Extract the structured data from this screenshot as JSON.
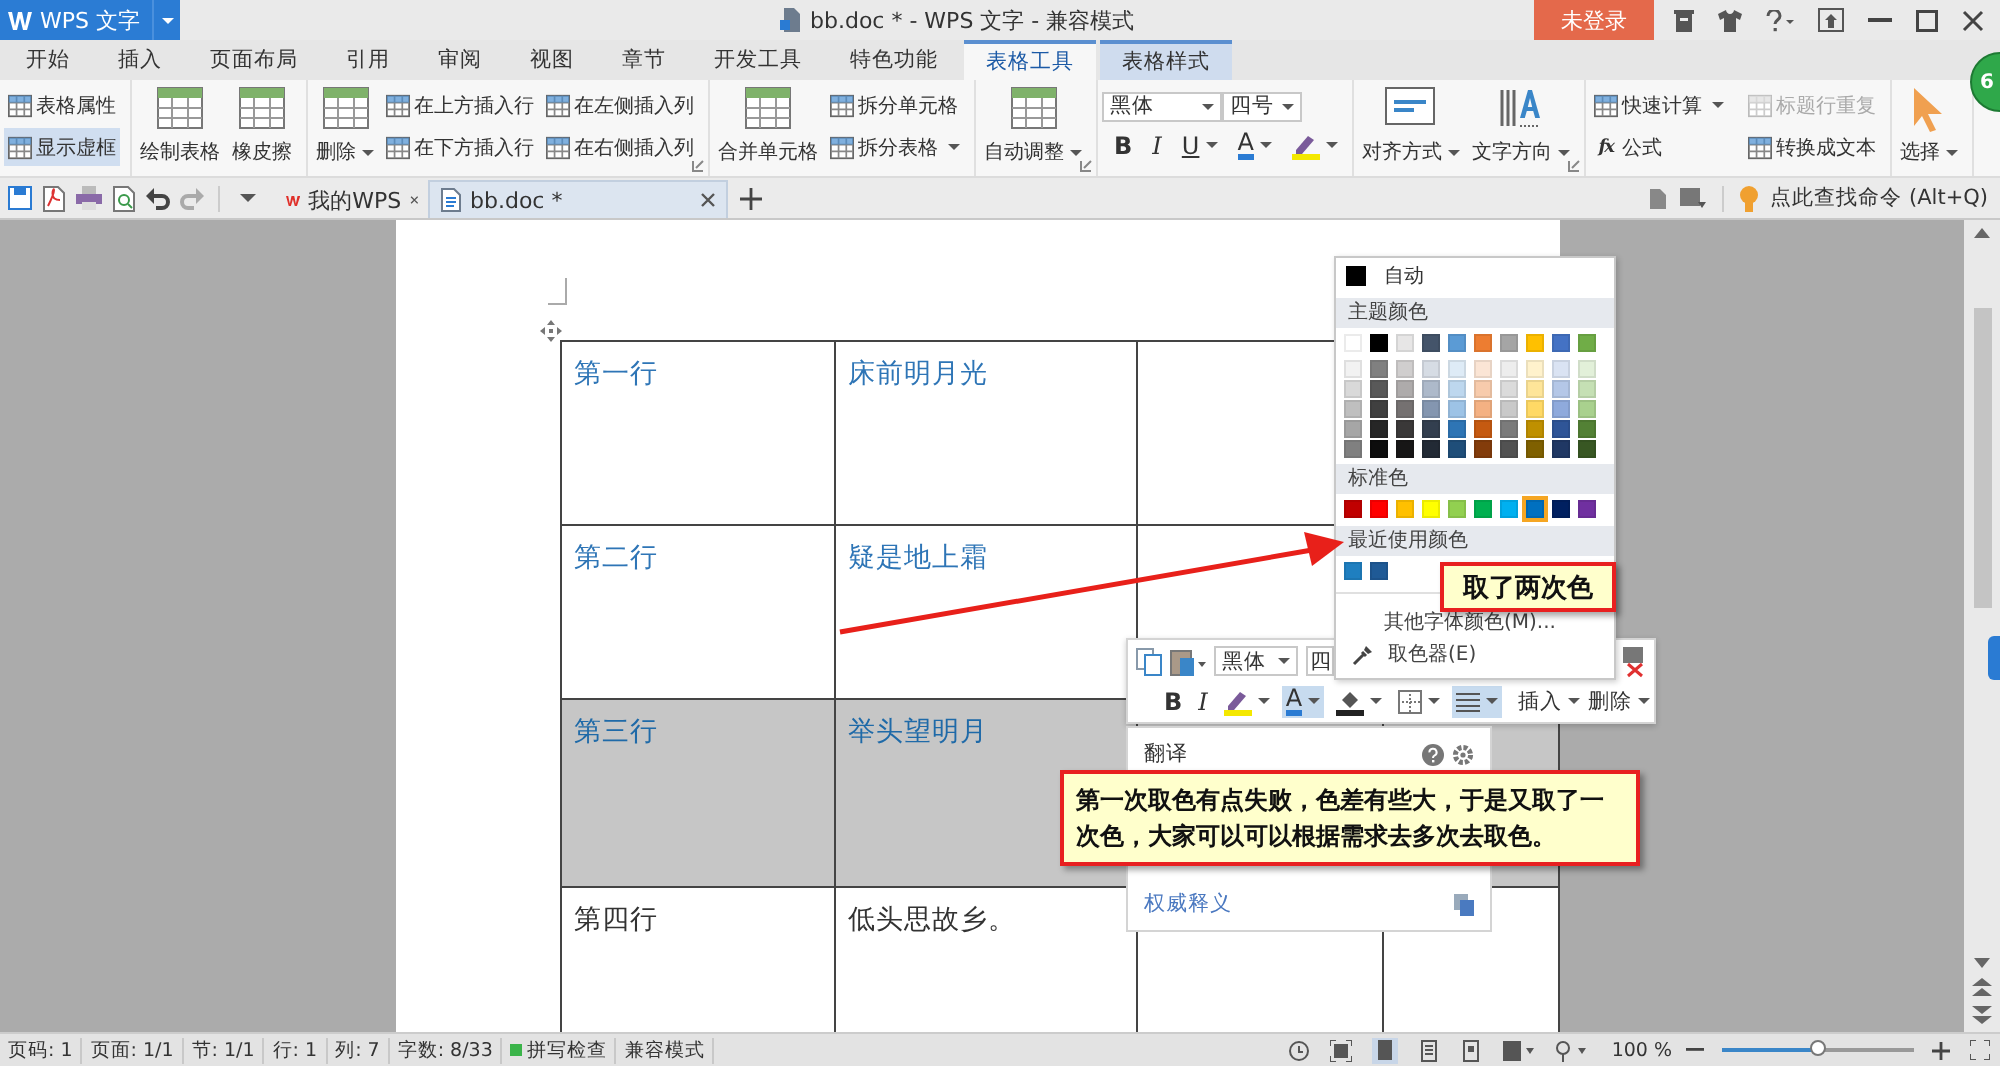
{
  "window": {
    "app_button": "WPS 文字",
    "title": "bb.doc * - WPS 文字 - 兼容模式",
    "login_button": "未登录",
    "badge": "6"
  },
  "menu_tabs": [
    {
      "label": "开始",
      "selected": false,
      "contextual": false
    },
    {
      "label": "插入",
      "selected": false,
      "contextual": false
    },
    {
      "label": "页面布局",
      "selected": false,
      "contextual": false
    },
    {
      "label": "引用",
      "selected": false,
      "contextual": false
    },
    {
      "label": "审阅",
      "selected": false,
      "contextual": false
    },
    {
      "label": "视图",
      "selected": false,
      "contextual": false
    },
    {
      "label": "章节",
      "selected": false,
      "contextual": false
    },
    {
      "label": "开发工具",
      "selected": false,
      "contextual": false
    },
    {
      "label": "特色功能",
      "selected": false,
      "contextual": false
    },
    {
      "label": "表格工具",
      "selected": true,
      "contextual": true
    },
    {
      "label": "表格样式",
      "selected": false,
      "contextual": true
    }
  ],
  "ribbon": {
    "groups": [
      {
        "launcher": false,
        "items": [
          {
            "kind": "small",
            "label": "表格属性",
            "dropdown": false,
            "on": false
          },
          {
            "kind": "small",
            "label": "显示虚框",
            "dropdown": false,
            "on": true
          }
        ]
      },
      {
        "launcher": false,
        "items": [
          {
            "kind": "large",
            "label": "绘制表格",
            "dropdown": false
          },
          {
            "kind": "large",
            "label": "橡皮擦",
            "dropdown": false
          }
        ]
      },
      {
        "launcher": true,
        "items": [
          {
            "kind": "large",
            "label": "删除",
            "dropdown": true
          },
          {
            "kind": "small",
            "label": "在上方插入行",
            "dropdown": false
          },
          {
            "kind": "small",
            "label": "在下方插入行",
            "dropdown": false
          },
          {
            "kind": "small",
            "label": "在左侧插入列",
            "dropdown": false
          },
          {
            "kind": "small",
            "label": "在右侧插入列",
            "dropdown": false
          }
        ]
      },
      {
        "launcher": false,
        "items": [
          {
            "kind": "large",
            "label": "合并单元格",
            "dropdown": false
          },
          {
            "kind": "small",
            "label": "拆分单元格",
            "dropdown": false
          },
          {
            "kind": "small",
            "label": "拆分表格",
            "dropdown": true
          }
        ]
      },
      {
        "launcher": true,
        "items": [
          {
            "kind": "large",
            "label": "自动调整",
            "dropdown": true
          }
        ]
      },
      {
        "launcher": false,
        "items": [
          {
            "kind": "font",
            "font": "黑体",
            "size": "四号",
            "buttons": [
              {
                "kind": "bold",
                "label": "B",
                "dropdown": false
              },
              {
                "kind": "italic",
                "label": "I",
                "dropdown": false
              },
              {
                "kind": "underline",
                "label": "U",
                "dropdown": true
              },
              {
                "kind": "font_color",
                "label": "A",
                "dropdown": true
              },
              {
                "kind": "highlight",
                "dropdown": true
              }
            ]
          }
        ]
      },
      {
        "launcher": true,
        "items": [
          {
            "kind": "large",
            "label": "对齐方式",
            "dropdown": true
          },
          {
            "kind": "large",
            "label": "文字方向",
            "dropdown": true
          }
        ]
      },
      {
        "launcher": false,
        "items": [
          {
            "kind": "small",
            "label": "快速计算",
            "dropdown": true,
            "disabled": false
          },
          {
            "kind": "small",
            "label": "标题行重复",
            "dropdown": false,
            "disabled": true
          },
          {
            "kind": "small",
            "label": "公式",
            "symbol": "fx",
            "dropdown": false,
            "disabled": false
          },
          {
            "kind": "small",
            "label": "转换成文本",
            "dropdown": false,
            "disabled": false
          }
        ]
      },
      {
        "launcher": false,
        "items": [
          {
            "kind": "large",
            "label": "选择",
            "dropdown": true
          }
        ]
      }
    ]
  },
  "doc_tabs": [
    {
      "kind": "home",
      "label": "我的WPS",
      "selected": false
    },
    {
      "kind": "document",
      "label": "bb.doc *",
      "selected": true
    }
  ],
  "command_search": "点此查找命令 (Alt+Q)",
  "table": {
    "rows": [
      {
        "shaded": false,
        "cells": [
          {
            "text": "第一行",
            "color": "#2e75b6"
          },
          {
            "text": "床前明月光",
            "color": "#2e75b6"
          },
          {},
          {}
        ]
      },
      {
        "shaded": false,
        "cells": [
          {
            "text": "第二行",
            "color": "#2e75b6"
          },
          {
            "text": "疑是地上霜",
            "color": "#2e75b6"
          },
          {},
          {}
        ]
      },
      {
        "shaded": true,
        "cells": [
          {
            "text": "第三行",
            "color": "#1f6aa8"
          },
          {
            "text": "举头望明月",
            "color": "#1f6aa8"
          },
          {},
          {}
        ]
      },
      {
        "shaded": false,
        "cells": [
          {
            "text": "第四行",
            "color": "#333333"
          },
          {
            "text": "低头思故乡。",
            "color": "#333333"
          },
          {},
          {}
        ]
      }
    ]
  },
  "color_menu": {
    "auto_label": "自动",
    "theme_heading": "主题颜色",
    "theme_colors": [
      {
        "color": "#ffffff",
        "selected": false
      },
      {
        "color": "#000000",
        "selected": false
      },
      {
        "color": "#e7e6e6",
        "selected": false
      },
      {
        "color": "#44546a",
        "selected": false
      },
      {
        "color": "#5b9bd5",
        "selected": false
      },
      {
        "color": "#ed7d31",
        "selected": false
      },
      {
        "color": "#a5a5a5",
        "selected": false
      },
      {
        "color": "#ffc000",
        "selected": false
      },
      {
        "color": "#4472c4",
        "selected": false
      },
      {
        "color": "#70ad47",
        "selected": false
      }
    ],
    "shade_rows": [
      [
        {
          "color": "#f2f2f2",
          "selected": false
        },
        {
          "color": "#808080",
          "selected": false
        },
        {
          "color": "#d0cece",
          "selected": false
        },
        {
          "color": "#d6dce4",
          "selected": false
        },
        {
          "color": "#deebf6",
          "selected": false
        },
        {
          "color": "#fbe5d5",
          "selected": false
        },
        {
          "color": "#ededed",
          "selected": false
        },
        {
          "color": "#fff2cc",
          "selected": false
        },
        {
          "color": "#dae3f3",
          "selected": false
        },
        {
          "color": "#e2f0d9",
          "selected": false
        }
      ],
      [
        {
          "color": "#d9d9d9",
          "selected": false
        },
        {
          "color": "#595959",
          "selected": false
        },
        {
          "color": "#aeabab",
          "selected": false
        },
        {
          "color": "#adb9ca",
          "selected": false
        },
        {
          "color": "#bdd7ee",
          "selected": false
        },
        {
          "color": "#f7cbac",
          "selected": false
        },
        {
          "color": "#dbdbdb",
          "selected": false
        },
        {
          "color": "#fee599",
          "selected": false
        },
        {
          "color": "#b4c7e7",
          "selected": false
        },
        {
          "color": "#c5e0b4",
          "selected": false
        }
      ],
      [
        {
          "color": "#bfbfbf",
          "selected": false
        },
        {
          "color": "#404040",
          "selected": false
        },
        {
          "color": "#757171",
          "selected": false
        },
        {
          "color": "#8496b0",
          "selected": false
        },
        {
          "color": "#9dc3e6",
          "selected": false
        },
        {
          "color": "#f4b183",
          "selected": false
        },
        {
          "color": "#c9c9c9",
          "selected": false
        },
        {
          "color": "#ffd965",
          "selected": false
        },
        {
          "color": "#8faadc",
          "selected": false
        },
        {
          "color": "#a9d18e",
          "selected": false
        }
      ],
      [
        {
          "color": "#a6a6a6",
          "selected": false
        },
        {
          "color": "#262626",
          "selected": false
        },
        {
          "color": "#3a3838",
          "selected": false
        },
        {
          "color": "#333f4f",
          "selected": false
        },
        {
          "color": "#2e75b5",
          "selected": false
        },
        {
          "color": "#c55a11",
          "selected": false
        },
        {
          "color": "#7b7b7b",
          "selected": false
        },
        {
          "color": "#bf9000",
          "selected": false
        },
        {
          "color": "#2f5597",
          "selected": false
        },
        {
          "color": "#538135",
          "selected": false
        }
      ],
      [
        {
          "color": "#808080",
          "selected": false
        },
        {
          "color": "#0d0d0d",
          "selected": false
        },
        {
          "color": "#171616",
          "selected": false
        },
        {
          "color": "#222a35",
          "selected": false
        },
        {
          "color": "#1f4e79",
          "selected": false
        },
        {
          "color": "#833c0b",
          "selected": false
        },
        {
          "color": "#525252",
          "selected": false
        },
        {
          "color": "#7f6000",
          "selected": false
        },
        {
          "color": "#203864",
          "selected": false
        },
        {
          "color": "#385723",
          "selected": false
        }
      ]
    ],
    "standard_heading": "标准色",
    "standard_colors": [
      {
        "color": "#c00000",
        "selected": false
      },
      {
        "color": "#ff0000",
        "selected": false
      },
      {
        "color": "#ffc000",
        "selected": false
      },
      {
        "color": "#ffff00",
        "selected": false
      },
      {
        "color": "#92d050",
        "selected": false
      },
      {
        "color": "#00b050",
        "selected": false
      },
      {
        "color": "#00b0f0",
        "selected": false
      },
      {
        "color": "#0070c0",
        "selected": true
      },
      {
        "color": "#002060",
        "selected": false
      },
      {
        "color": "#7030a0",
        "selected": false
      }
    ],
    "recent_heading": "最近使用颜色",
    "recent_colors": [
      {
        "color": "#1f7fc0",
        "selected": false
      },
      {
        "color": "#1f5a96",
        "selected": false
      }
    ],
    "more_label": "其他字体颜色(M)...",
    "picker_label": "取色器(E)"
  },
  "mini_toolbar": {
    "font": "黑体",
    "size": "四",
    "buttons": [
      {
        "kind": "bold",
        "label": "B",
        "active": false,
        "dropdown": false
      },
      {
        "kind": "italic",
        "label": "I",
        "active": false,
        "dropdown": false
      },
      {
        "kind": "highlight",
        "active": false,
        "dropdown": true
      },
      {
        "kind": "font_color",
        "label": "A",
        "active": true,
        "dropdown": true
      },
      {
        "kind": "fill",
        "active": false,
        "dropdown": true
      },
      {
        "kind": "border",
        "active": false,
        "dropdown": true
      },
      {
        "kind": "align",
        "active": true,
        "dropdown": true
      }
    ],
    "menus": [
      {
        "label": "插入"
      },
      {
        "label": "删除"
      }
    ]
  },
  "translate_panel": {
    "title": "翻译",
    "link": "权威释义"
  },
  "callouts": [
    {
      "text": "取了两次色"
    },
    {
      "text": "第一次取色有点失败，色差有些大，于是又取了一次色，大家可以可以根据需求去多次去取色。"
    }
  ],
  "status_bar": {
    "items": [
      {
        "kind": "plain",
        "text": "页码: 1"
      },
      {
        "kind": "plain",
        "text": "页面: 1/1"
      },
      {
        "kind": "plain",
        "text": "节: 1/1"
      },
      {
        "kind": "plain",
        "text": "行: 1"
      },
      {
        "kind": "plain",
        "text": "列: 7"
      },
      {
        "kind": "plain",
        "text": "字数: 8/33"
      },
      {
        "kind": "check",
        "text": "拼写检查"
      },
      {
        "kind": "plain",
        "text": "兼容模式"
      }
    ],
    "zoom": {
      "value": "100 %",
      "level": 0.5
    }
  }
}
